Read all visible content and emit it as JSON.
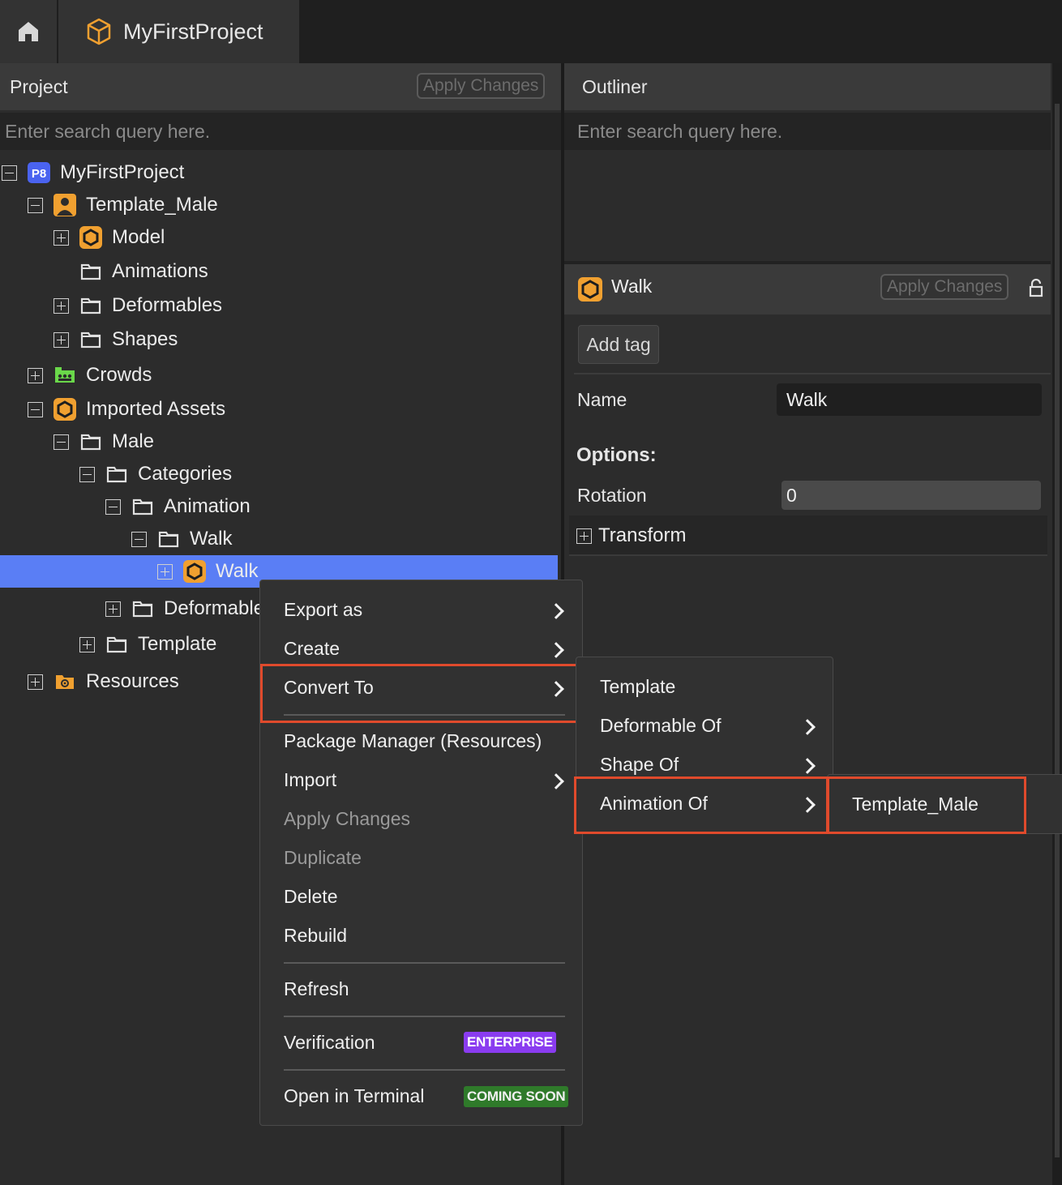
{
  "topbar": {
    "project_tab": "MyFirstProject"
  },
  "project_panel": {
    "title": "Project",
    "apply_changes": "Apply Changes",
    "search_placeholder": "Enter search query here."
  },
  "outliner_panel": {
    "title": "Outliner",
    "search_placeholder": "Enter search query here."
  },
  "tree": [
    {
      "label": "MyFirstProject",
      "icon": "p8-logo-icon",
      "toggle": "minus",
      "depth": 0
    },
    {
      "label": "Template_Male",
      "icon": "template-person-icon",
      "toggle": "minus",
      "depth": 1
    },
    {
      "label": "Model",
      "icon": "hexagon-asset-icon",
      "toggle": "plus",
      "depth": 2
    },
    {
      "label": "Animations",
      "icon": "folder-icon",
      "toggle": "none",
      "depth": 2
    },
    {
      "label": "Deformables",
      "icon": "folder-icon",
      "toggle": "plus",
      "depth": 2
    },
    {
      "label": "Shapes",
      "icon": "folder-icon",
      "toggle": "plus",
      "depth": 2
    },
    {
      "label": "Crowds",
      "icon": "crowds-icon",
      "toggle": "plus",
      "depth": 1
    },
    {
      "label": "Imported Assets",
      "icon": "hexagon-asset-icon",
      "toggle": "minus",
      "depth": 1
    },
    {
      "label": "Male",
      "icon": "folder-icon",
      "toggle": "minus",
      "depth": 2
    },
    {
      "label": "Categories",
      "icon": "folder-icon",
      "toggle": "minus",
      "depth": 3
    },
    {
      "label": "Animation",
      "icon": "folder-icon",
      "toggle": "minus",
      "depth": 4
    },
    {
      "label": "Walk",
      "icon": "folder-icon",
      "toggle": "minus",
      "depth": 5
    },
    {
      "label": "Walk",
      "icon": "hexagon-asset-icon",
      "toggle": "plus",
      "depth": 6,
      "selected": true
    },
    {
      "label": "Deformables",
      "icon": "folder-icon",
      "toggle": "plus",
      "depth": 4
    },
    {
      "label": "Template",
      "icon": "folder-icon",
      "toggle": "plus",
      "depth": 3
    },
    {
      "label": "Resources",
      "icon": "resources-folder-icon",
      "toggle": "plus",
      "depth": 1
    }
  ],
  "properties": {
    "asset_name": "Walk",
    "apply_changes": "Apply Changes",
    "add_tag": "Add tag",
    "name_label": "Name",
    "name_value": "Walk",
    "options_heading": "Options:",
    "rotation_label": "Rotation",
    "rotation_value": "0",
    "transform_label": "Transform"
  },
  "context_menu": {
    "export_as": "Export as",
    "create": "Create",
    "convert_to": "Convert To",
    "package_manager": "Package Manager (Resources)",
    "import": "Import",
    "apply_changes": "Apply Changes",
    "duplicate": "Duplicate",
    "delete": "Delete",
    "rebuild": "Rebuild",
    "refresh": "Refresh",
    "verification": "Verification",
    "enterprise_badge": "ENTERPRISE",
    "open_terminal": "Open in Terminal",
    "coming_soon_badge": "COMING SOON"
  },
  "convert_submenu": {
    "template": "Template",
    "deformable_of": "Deformable Of",
    "shape_of": "Shape Of",
    "animation_of": "Animation Of"
  },
  "animation_submenu": {
    "template_male": "Template_Male"
  },
  "colors": {
    "accent_orange": "#f0a030",
    "selection_blue": "#5a7ef5",
    "highlight_red": "#e04a2c",
    "enterprise_purple": "#8a3cf0",
    "coming_soon_green": "#2f7a2a",
    "p8_logo_blue": "#4a63f0",
    "crowds_green": "#6ad84a"
  }
}
